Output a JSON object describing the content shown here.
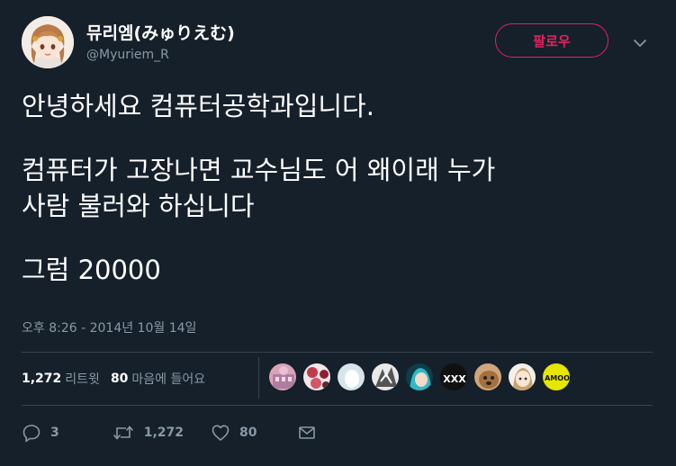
{
  "user": {
    "display_name": "뮤리엠(みゅりえむ)",
    "handle": "@Myuriem_R"
  },
  "follow_button_label": "팔로우",
  "tweet": {
    "lines": [
      "안녕하세요 컴퓨터공학과입니다.",
      "컴퓨터가 고장나면 교수님도 어 왜이래 누가",
      "사람 불러와 하십니다",
      "그럼 20000"
    ],
    "timestamp": "오후 8:26 - 2014년 10월 14일"
  },
  "stats": {
    "retweets_count": "1,272",
    "retweets_label": "리트윗",
    "likes_count": "80",
    "likes_label": "마음에 들어요"
  },
  "likers": [
    {
      "icon": "avatar-pink-building"
    },
    {
      "icon": "avatar-red-flowers"
    },
    {
      "icon": "avatar-white-egg"
    },
    {
      "icon": "avatar-manga-sketch"
    },
    {
      "icon": "avatar-teal-hair"
    },
    {
      "icon": "avatar-pss-logo",
      "label": "XXX"
    },
    {
      "icon": "avatar-brown-dog"
    },
    {
      "icon": "avatar-anime-girl"
    },
    {
      "icon": "avatar-yellow-badge",
      "label": "AMOO"
    }
  ],
  "actions": {
    "reply_count": "3",
    "retweet_count": "1,272",
    "like_count": "80"
  },
  "colors": {
    "background": "#15202b",
    "text": "#ffffff",
    "muted": "#8899a6",
    "follow_accent": "#e0245e",
    "divider": "#38444d"
  }
}
